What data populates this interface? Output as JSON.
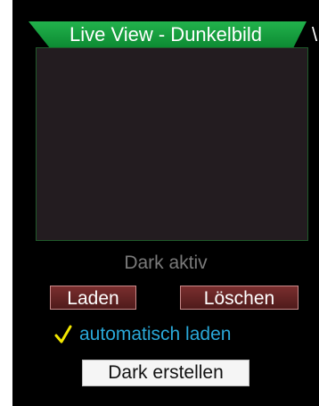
{
  "window": {
    "title": "Live View - Dunkelbild",
    "edge_glyph": "\\"
  },
  "status": {
    "text": "Dark aktiv"
  },
  "buttons": {
    "load": "Laden",
    "delete": "Löschen",
    "create": "Dark erstellen"
  },
  "auto_load": {
    "label": "automatisch laden",
    "checked": true,
    "icon": "checkmark-icon"
  },
  "colors": {
    "tab_green": "#0f9a3a",
    "button_red": "#5b2121",
    "check_yellow": "#f2e600",
    "label_blue": "#2aa8d8",
    "status_gray": "#7a7a7a"
  }
}
